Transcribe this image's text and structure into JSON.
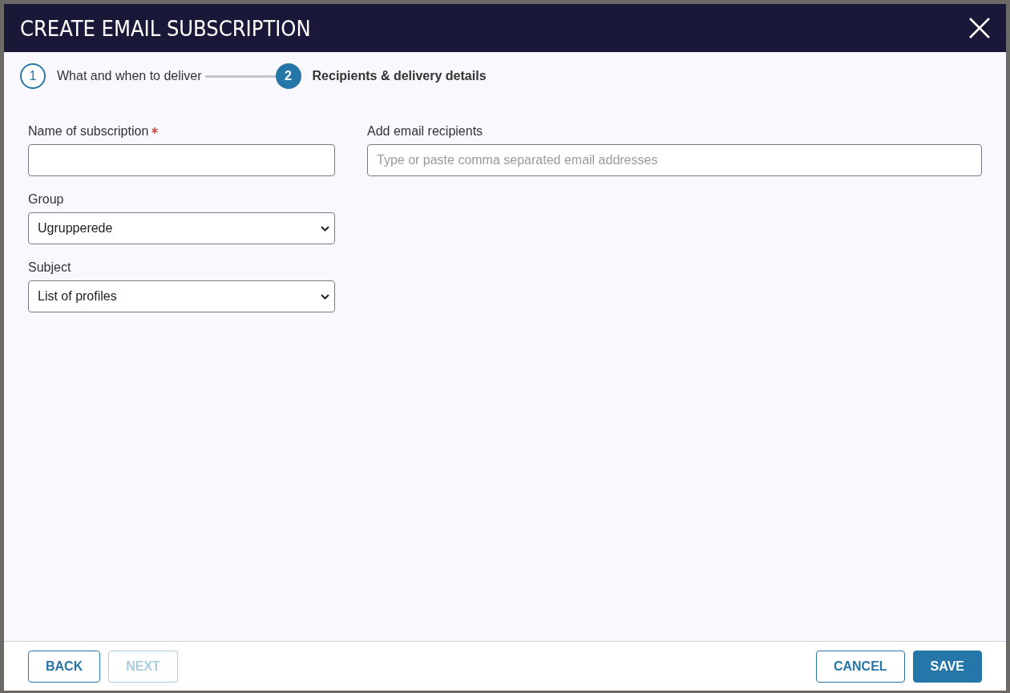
{
  "dialog": {
    "title": "CREATE EMAIL SUBSCRIPTION"
  },
  "steps": [
    {
      "number": "1",
      "label": "What and when to deliver",
      "selected": false
    },
    {
      "number": "2",
      "label": "Recipients & delivery details",
      "selected": true
    }
  ],
  "left_fields": [
    {
      "kind": "input",
      "label": "Name of subscription",
      "required": true
    },
    {
      "kind": "select",
      "label": "Group",
      "required": false,
      "value": "Ugrupperede"
    },
    {
      "kind": "select",
      "label": "Subject",
      "required": false,
      "value": "List of profiles"
    }
  ],
  "right_fields": [
    {
      "kind": "input",
      "label": "Add email recipients",
      "required": false,
      "placeholder": "Type or paste comma separated email addresses"
    }
  ],
  "footer_left": [
    {
      "label": "BACK",
      "kind": "outline",
      "disabled": false
    },
    {
      "label": "NEXT",
      "kind": "outline",
      "disabled": true
    }
  ],
  "footer_right": [
    {
      "label": "CANCEL",
      "kind": "outline",
      "disabled": false
    },
    {
      "label": "SAVE",
      "kind": "filled",
      "disabled": false
    }
  ]
}
